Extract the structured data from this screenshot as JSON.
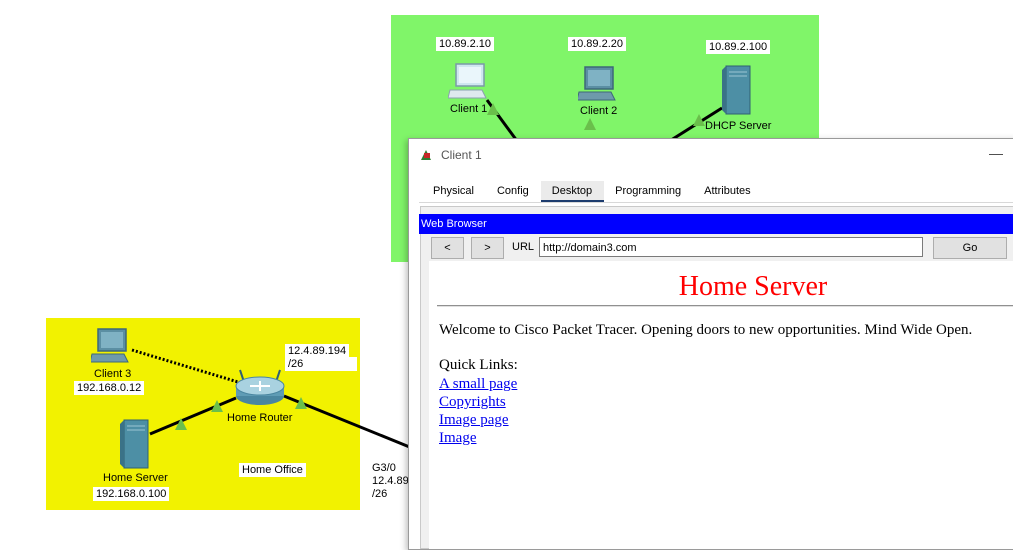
{
  "topology": {
    "top_network": {
      "client1": {
        "ip": "10.89.2.10",
        "label": "Client 1"
      },
      "client2": {
        "ip": "10.89.2.20",
        "label": "Client 2"
      },
      "dhcp_server": {
        "ip": "10.89.2.100",
        "label": "DHCP Server"
      }
    },
    "home_office": {
      "area_label": "Home Office",
      "client3": {
        "label": "Client 3",
        "ip": "192.168.0.12"
      },
      "home_router": {
        "label": "Home Router",
        "wan_ip": "12.4.89.194",
        "wan_mask": "/26"
      },
      "home_server": {
        "label": "Home Server",
        "ip": "192.168.0.100"
      }
    },
    "isp_link": {
      "interface": "G3/0",
      "ip": "12.4.89",
      "mask": "/26"
    },
    "colors": {
      "top_zone": "#80f569",
      "home_zone": "#f2f200",
      "link_indicator": "#6abf4b"
    }
  },
  "window": {
    "title": "Client 1",
    "title_icon": "packet-tracer-icon",
    "minimize_glyph": "—",
    "tabs": [
      "Physical",
      "Config",
      "Desktop",
      "Programming",
      "Attributes"
    ],
    "active_tab": "Desktop",
    "browser": {
      "title": "Web Browser",
      "back_label": "<",
      "forward_label": ">",
      "url_label": "URL",
      "url": "http://domain3.com",
      "go_label": "Go",
      "page": {
        "heading": "Home Server",
        "welcome": "Welcome to Cisco Packet Tracer. Opening doors to new opportunities. Mind Wide Open.",
        "quick_links_label": "Quick Links:",
        "links": [
          "A small page",
          "Copyrights",
          "Image page",
          "Image"
        ]
      }
    }
  }
}
